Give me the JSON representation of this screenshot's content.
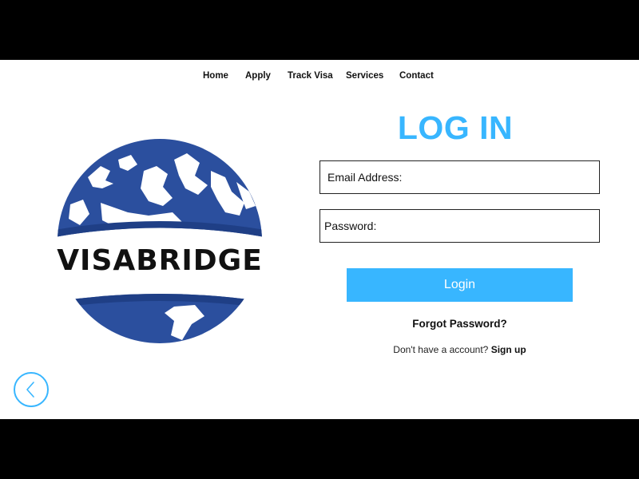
{
  "nav": {
    "items": [
      "Home",
      "Apply",
      "Track Visa",
      "Services",
      "Contact"
    ]
  },
  "logo": {
    "text": "VISABRIDGE",
    "icon": "globe-icon"
  },
  "login": {
    "title": "LOG IN",
    "email_label": "Email Address:",
    "password_label": "Password:",
    "button_label": "Login",
    "forgot_link": "Forgot Password?",
    "signup_prompt": "Don't have a account?",
    "signup_link": "Sign up"
  },
  "back_button": {
    "icon": "chevron-left-icon"
  },
  "colors": {
    "accent": "#38b6ff",
    "globe": "#2b4f9e"
  }
}
